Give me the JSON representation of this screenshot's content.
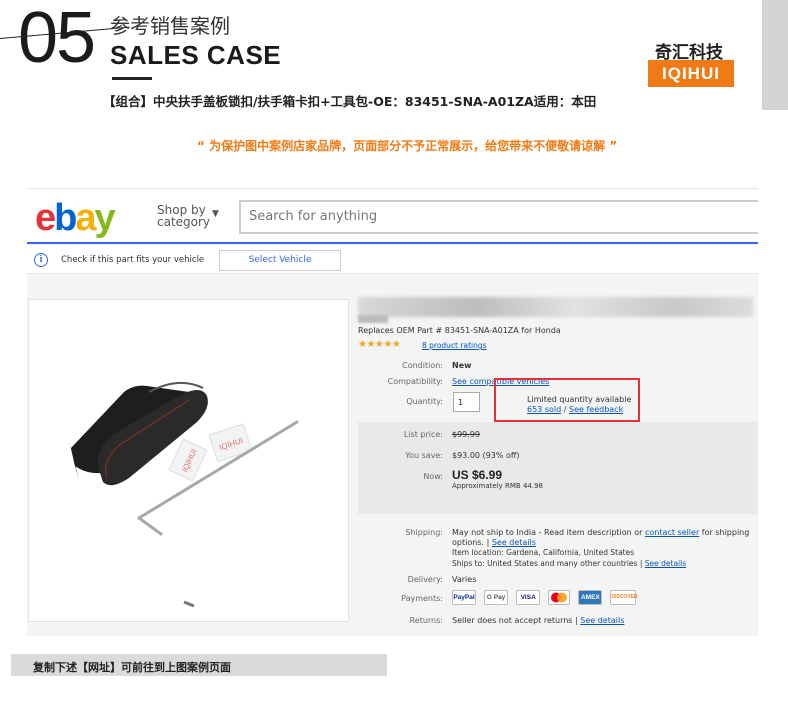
{
  "header": {
    "number": "05",
    "title_cn": "参考销售案例",
    "title_en": "SALES CASE",
    "brand_cn": "奇汇科技",
    "brand_en": "IQIHUI",
    "brand_color": "#f07b14"
  },
  "product_line": "【组合】中央扶手盖板锁扣/扶手箱卡扣+工具包-OE：83451-SNA-A01ZA适用：本田",
  "notice": "“ 为保护图中案例店家品牌，页面部分不予正常展示，给您带来不便敬请谅解 ”",
  "ebay": {
    "logo": {
      "e": "e",
      "b": "b",
      "a": "a",
      "y": "y"
    },
    "shop_by": "Shop by",
    "category": "category",
    "search_placeholder": "Search for anything",
    "fit_text": "Check if this part fits your vehicle",
    "select_vehicle": "Select Vehicle",
    "sticker_text": "IQIHUI"
  },
  "listing": {
    "replaces": "Replaces OEM Part # 83451-SNA-A01ZA for Honda",
    "stars": "★★★★★",
    "ratings": "8 product ratings",
    "condition_label": "Condition:",
    "condition": "New",
    "compat_label": "Compatibility:",
    "compat": "See compatible vehicles",
    "qty_label": "Quantity:",
    "qty": "1",
    "limited": "Limited quantity available",
    "sold": "653 sold",
    "sep": "/",
    "feedback": "See feedback",
    "list_price_label": "List price:",
    "list_price": "$99.99",
    "save_label": "You save:",
    "save": "$93.00 (93% off)",
    "now_label": "Now:",
    "now_price": "US $6.99",
    "approx": "Approximately RMB 44.98",
    "shipping_label": "Shipping:",
    "shipping_1a": "May not ship to India - Read item description or",
    "contact_seller": "contact seller",
    "shipping_1b": "for shipping",
    "shipping_2": "options.",
    "pipe": "|",
    "see_details": "See details",
    "item_location": "Item location: Gardena, California, United States",
    "ships_to": "Ships to: United States and many other countries",
    "delivery_label": "Delivery:",
    "delivery": "Varies",
    "payments_label": "Payments:",
    "payments": [
      "PayPal",
      "G Pay",
      "VISA",
      "MC",
      "AMEX",
      "DISCOVER"
    ],
    "returns_label": "Returns:",
    "returns": "Seller does not accept returns"
  },
  "footer": "复制下述【网址】可前往到上图案例页面"
}
